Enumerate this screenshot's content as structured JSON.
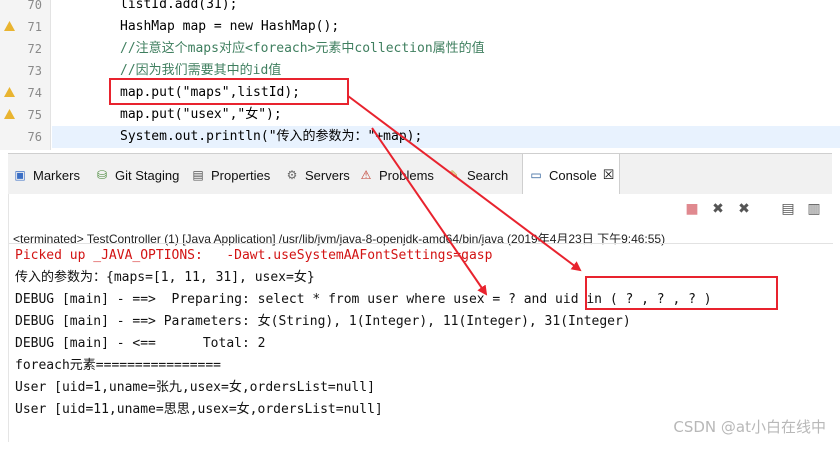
{
  "editor": {
    "lines": [
      {
        "num": "70",
        "text": "listId.add(31);"
      },
      {
        "num": "71",
        "text": "HashMap map = new HashMap();"
      },
      {
        "num": "72",
        "text": "//注意这个maps对应<foreach>元素中collection属性的值"
      },
      {
        "num": "73",
        "text": "//因为我们需要其中的id值"
      },
      {
        "num": "74",
        "text": "map.put(\"maps\",listId);"
      },
      {
        "num": "75",
        "text": "map.put(\"usex\",\"女\");"
      },
      {
        "num": "76",
        "text": "System.out.println(\"传入的参数为：\"+map);"
      }
    ]
  },
  "tabs": [
    {
      "label": "Markers",
      "icon": "markers-icon"
    },
    {
      "label": "Git Staging",
      "icon": "git-staging-icon"
    },
    {
      "label": "Properties",
      "icon": "properties-icon"
    },
    {
      "label": "Servers",
      "icon": "servers-icon"
    },
    {
      "label": "Problems",
      "icon": "problems-icon"
    },
    {
      "label": "Search",
      "icon": "search-icon"
    },
    {
      "label": "Console",
      "icon": "console-icon",
      "close": "☒"
    }
  ],
  "console": {
    "status": "<terminated> TestController (1) [Java Application] /usr/lib/jvm/java-8-openjdk-amd64/bin/java (2019年4月23日 下午9:46:55)",
    "output": [
      "Picked up _JAVA_OPTIONS:   -Dawt.useSystemAAFontSettings=gasp",
      "传入的参数为：{maps=[1, 11, 31], usex=女}",
      "DEBUG [main] - ==>  Preparing: select * from user where usex = ? and uid in ( ? , ? , ? )",
      "DEBUG [main] - ==> Parameters: 女(String), 1(Integer), 11(Integer), 31(Integer)",
      "DEBUG [main] - <==      Total: 2",
      "foreach元素================",
      "User [uid=1,uname=张九,usex=女,ordersList=null]",
      "User [uid=11,uname=思思,usex=女,ordersList=null]"
    ]
  },
  "watermark": "CSDN @at小白在线中",
  "colors": {
    "annotation": "#e8232e",
    "stderr": "#d21313",
    "keyword": "#7f0055",
    "comment": "#3f7f5f",
    "string": "#2a00ff"
  }
}
